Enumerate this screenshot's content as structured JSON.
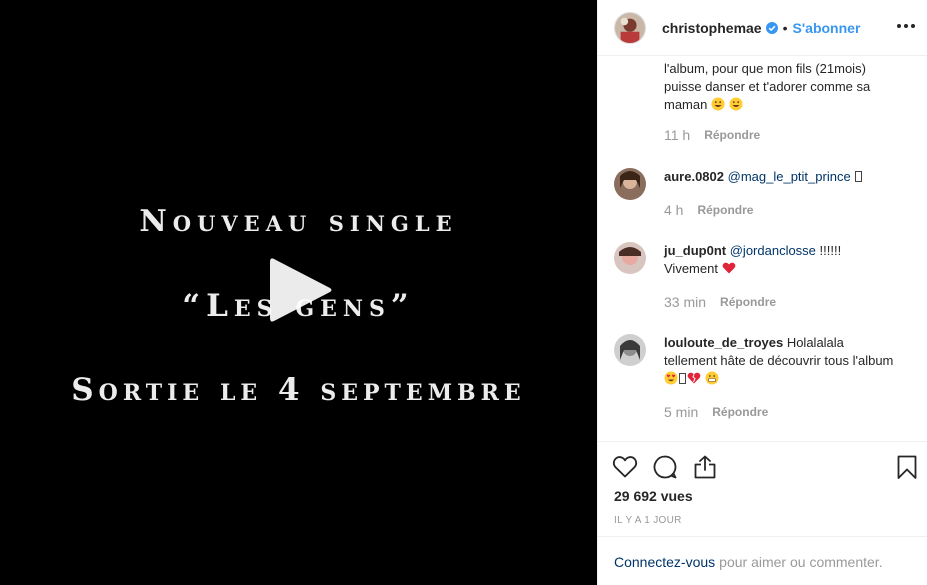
{
  "video": {
    "line1": "Nouveau single",
    "line2": "“Les gens”",
    "line3": "Sortie le 4 septembre"
  },
  "header": {
    "username": "christophemae",
    "dot": "•",
    "follow_label": "S'abonner"
  },
  "comments": {
    "continued_text": "l'album, pour que mon fils (21mois) puisse danser et t'adorer comme sa maman",
    "continued_time": "11 h",
    "items": [
      {
        "user": "aure.0802",
        "mention": "@mag_le_ptit_prince",
        "text": "",
        "time": "4 h"
      },
      {
        "user": "ju_dup0nt",
        "mention": "@jordanclosse",
        "text": " !!!!!! Vivement",
        "time": "33 min"
      },
      {
        "user": "louloute_de_troyes",
        "mention": "",
        "text": " Holalalala tellement hâte de découvrir tous l'album",
        "time": "5 min"
      }
    ],
    "reply_label": "Répondre"
  },
  "actions": {
    "views": "29 692 vues",
    "posted_ago": "Il y a 1 jour",
    "login_link": "Connectez-vous",
    "login_text": "pour aimer ou commenter."
  },
  "colors": {
    "accent": "#3897f0",
    "link": "#003569",
    "muted": "#999999",
    "text": "#262626"
  },
  "icons": [
    "play-icon",
    "verified-icon",
    "more-icon",
    "heart-icon",
    "comment-icon",
    "share-icon",
    "bookmark-icon"
  ]
}
